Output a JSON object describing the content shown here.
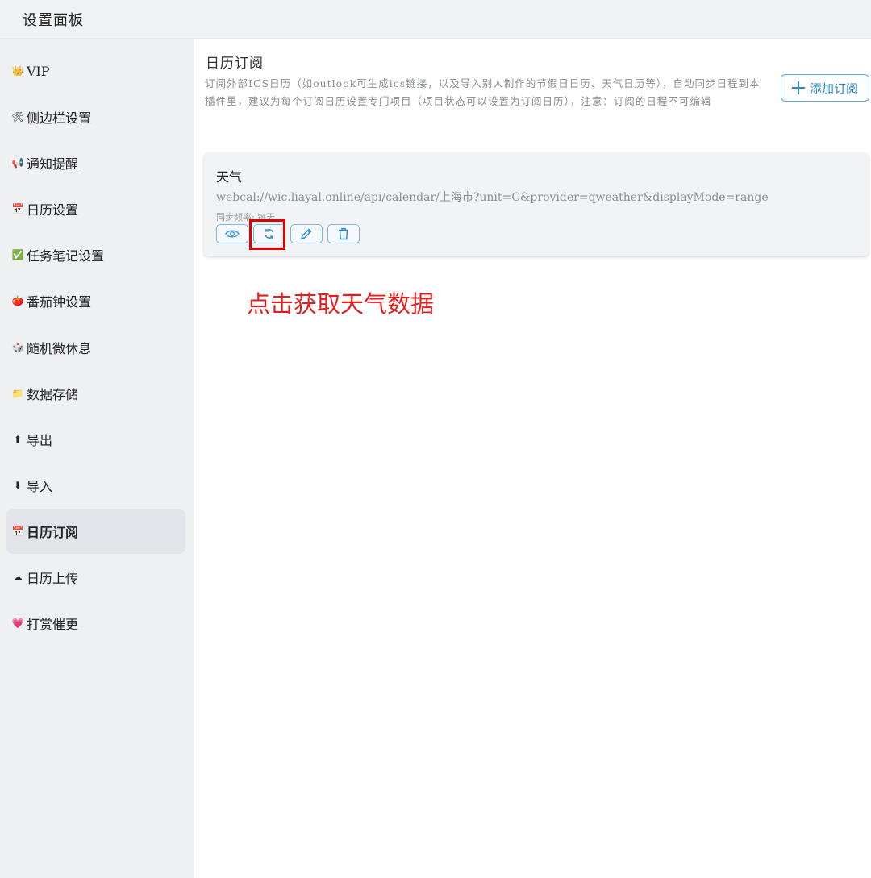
{
  "header": {
    "title": "设置面板"
  },
  "sidebar": {
    "items": [
      {
        "icon": "👑",
        "label": "VIP"
      },
      {
        "icon": "🛠",
        "label": "侧边栏设置"
      },
      {
        "icon": "📢",
        "label": "通知提醒"
      },
      {
        "icon": "📅",
        "label": "日历设置"
      },
      {
        "icon": "✅",
        "label": "任务笔记设置"
      },
      {
        "icon": "🍅",
        "label": "番茄钟设置"
      },
      {
        "icon": "🎲",
        "label": "随机微休息"
      },
      {
        "icon": "📁",
        "label": "数据存储"
      },
      {
        "icon": "⬆",
        "label": "导出"
      },
      {
        "icon": "⬇",
        "label": "导入"
      },
      {
        "icon": "📅",
        "label": "日历订阅"
      },
      {
        "icon": "☁",
        "label": "日历上传"
      },
      {
        "icon": "💗",
        "label": "打赏催更"
      }
    ],
    "active_index": 10
  },
  "main": {
    "title": "日历订阅",
    "description": "订阅外部ICS日历（如outlook可生成ics链接，以及导入别人制作的节假日日历、天气日历等），自动同步日程到本插件里，建议为每个订阅日历设置专门项目（项目状态可以设置为订阅日历），注意：订阅的日程不可编辑",
    "add_button_label": "添加订阅",
    "subscriptions": [
      {
        "name": "天气",
        "url": "webcal://wic.liayal.online/api/calendar/上海市?unit=C&provider=qweather&displayMode=range",
        "sync_frequency": "同步频率: 每天"
      }
    ]
  },
  "annotation": {
    "text": "点击获取天气数据",
    "color": "#e61d1d"
  },
  "colors": {
    "accent": "#2c8bc8",
    "highlight": "#e00000"
  }
}
